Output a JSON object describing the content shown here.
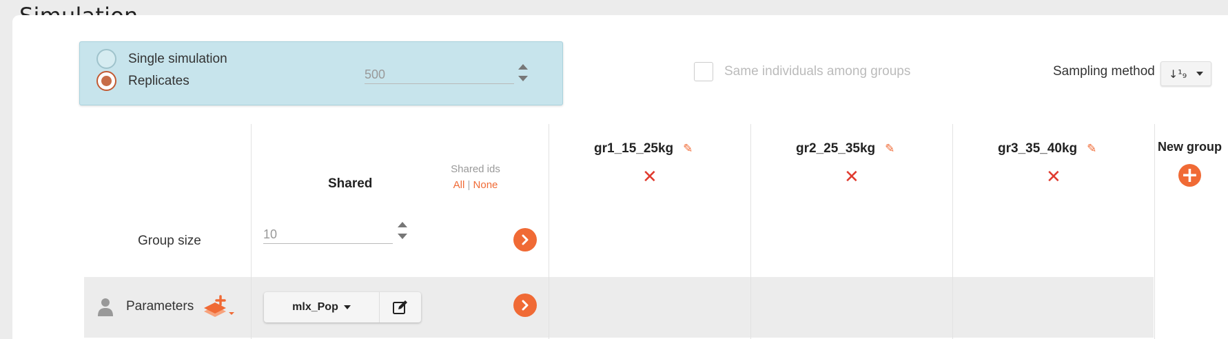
{
  "header": {
    "title": "Simulation"
  },
  "simulation_mode": {
    "options": [
      {
        "label": "Single simulation",
        "selected": false
      },
      {
        "label": "Replicates",
        "selected": true
      }
    ],
    "replicates_value": "500"
  },
  "same_individuals": {
    "label": "Same individuals among groups",
    "checked": false,
    "enabled": false
  },
  "sampling": {
    "label": "Sampling method",
    "icon": "sort-numeric-icon",
    "icon_glyph": "↓¹₉"
  },
  "shared": {
    "title": "Shared",
    "ids_label": "Shared ids",
    "all_link": "All",
    "separator": "|",
    "none_link": "None"
  },
  "groups": [
    {
      "name": "gr1_15_25kg"
    },
    {
      "name": "gr2_25_35kg"
    },
    {
      "name": "gr3_35_40kg"
    }
  ],
  "new_group": {
    "label": "New group"
  },
  "rows": {
    "group_size": {
      "label": "Group size",
      "value": "10"
    },
    "parameters": {
      "label": "Parameters",
      "dropdown_value": "mlx_Pop"
    }
  },
  "colors": {
    "accent": "#f06a35",
    "delete": "#e03a2e",
    "sim_box": "#c7e4ec",
    "radio_selected": "#c76d48"
  }
}
